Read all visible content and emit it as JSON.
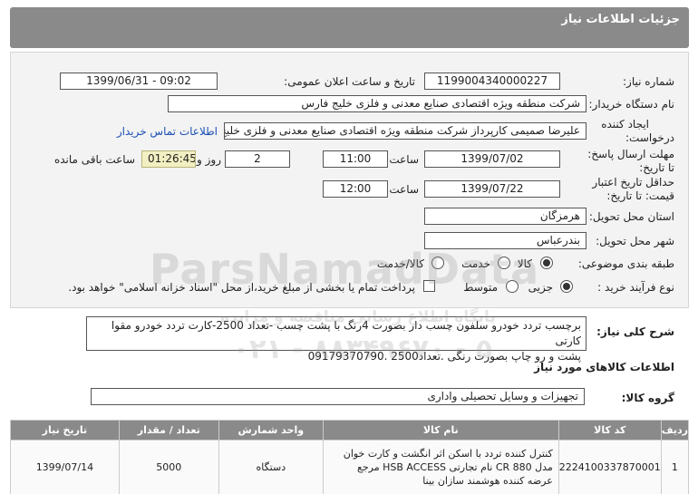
{
  "header": {
    "title": "جزئیات اطلاعات نیاز"
  },
  "need_number": {
    "label": "شماره نیاز:",
    "value": "1199004340000227"
  },
  "announce": {
    "label": "تاریخ و ساعت اعلان عمومی:",
    "value": "1399/06/31 - 09:02"
  },
  "buyer": {
    "label": "نام دستگاه خریدار:",
    "value": "شرکت منطقه ویژه اقتصادی صنایع معدنی و فلزی خلیج فارس"
  },
  "creator": {
    "label_line1": "ایجاد کننده",
    "label_line2": "درخواست:",
    "value": "علیرضا صمیمی کارپرداز شرکت منطقه ویژه اقتصادی صنایع معدنی و فلزی خلیج",
    "contact_link": "اطلاعات تماس خریدار"
  },
  "deadline": {
    "label_line1": "مهلت ارسال پاسخ:",
    "label_line2": "تا تاریخ:",
    "date": "1399/07/02",
    "time_label": "ساعت",
    "time": "11:00",
    "days": "2",
    "days_label": "روز و",
    "remaining": "01:26:45",
    "remaining_label": "ساعت باقی مانده"
  },
  "validity": {
    "label_line1": "حداقل تاریخ اعتبار",
    "label_line2": "قیمت: تا تاریخ:",
    "date": "1399/07/22",
    "time_label": "ساعت",
    "time": "12:00"
  },
  "province": {
    "label": "استان محل تحویل:",
    "value": "هرمزگان"
  },
  "city": {
    "label": "شهر محل تحویل:",
    "value": "بندرعباس"
  },
  "category": {
    "label": "طبقه بندی موضوعی:",
    "options": [
      "کالا",
      "خدمت",
      "کالا/خدمت"
    ],
    "selected": "کالا"
  },
  "process": {
    "label": "نوع فرآیند خرید :",
    "options": [
      "جزیی",
      "متوسط"
    ],
    "selected": "جزیی",
    "payment_note": "پرداخت تمام یا بخشی از مبلغ خرید،از محل \"اسناد خزانه اسلامی\" خواهد بود."
  },
  "description": {
    "label": "شرح کلی نیاز:",
    "line1": "برچسب تردد خودرو سلفون چسب دار  بصورت 4رنگ با پشت چسب -تعداد 2500-کارت تردد خودرو مقوا کارتی",
    "line2": "پشت و رو  چاپ بصورت رنگی .تعداد2500          .09179370790"
  },
  "items_section": {
    "title": "اطلاعات کالاهای مورد نیاز"
  },
  "goods_group": {
    "label": "گروه کالا:",
    "value": "تجهیزات و وسایل تحصیلی واداری"
  },
  "watermark": {
    "brand": "ParsNamadData",
    "line2": "پایگاه اطلاع رسانی مناقصه و مزایده",
    "phone": "۰۲۱ - ۸۸۳۴۹۶۷۰ - ۵"
  },
  "table": {
    "headers": [
      "ردیف",
      "کد کالا",
      "نام کالا",
      "واحد شمارش",
      "تعداد / مقدار",
      "تاریخ نیاز"
    ],
    "rows": [
      {
        "row": "1",
        "code": "2224100337870001",
        "name": "کنترل کننده تردد با اسکن اثر انگشت و کارت خوان مدل CR 880 نام تجارتی HSB ACCESS مرجع عرضه کننده هوشمند سازان بینا",
        "unit": "دستگاه",
        "qty": "5000",
        "date": "1399/07/14"
      }
    ]
  }
}
